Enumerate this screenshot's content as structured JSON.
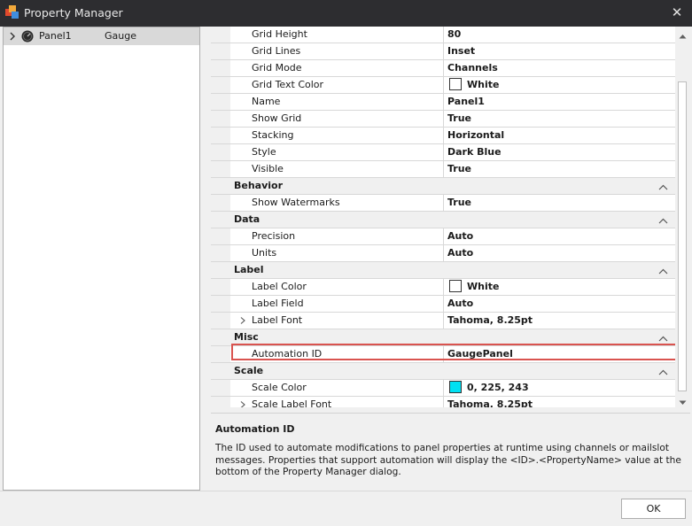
{
  "window": {
    "title": "Property Manager",
    "close_glyph": "✕"
  },
  "tree": {
    "items": [
      {
        "label": "Panel1",
        "type": "Gauge"
      }
    ]
  },
  "grid": {
    "appearance_rows": [
      {
        "name": "Grid Height",
        "value": "80"
      },
      {
        "name": "Grid Lines",
        "value": "Inset"
      },
      {
        "name": "Grid Mode",
        "value": "Channels"
      },
      {
        "name": "Grid Text Color",
        "value": "White",
        "color": "#ffffff"
      },
      {
        "name": "Name",
        "value": "Panel1"
      },
      {
        "name": "Show Grid",
        "value": "True"
      },
      {
        "name": "Stacking",
        "value": "Horizontal"
      },
      {
        "name": "Style",
        "value": "Dark Blue"
      },
      {
        "name": "Visible",
        "value": "True"
      }
    ],
    "categories": {
      "behavior": {
        "title": "Behavior",
        "rows": [
          {
            "name": "Show Watermarks",
            "value": "True"
          }
        ]
      },
      "data": {
        "title": "Data",
        "rows": [
          {
            "name": "Precision",
            "value": "Auto"
          },
          {
            "name": "Units",
            "value": "Auto"
          }
        ]
      },
      "label": {
        "title": "Label",
        "rows": [
          {
            "name": "Label Color",
            "value": "White",
            "color": "#ffffff"
          },
          {
            "name": "Label Field",
            "value": "Auto"
          },
          {
            "name": "Label Font",
            "value": "Tahoma, 8.25pt"
          }
        ]
      },
      "misc": {
        "title": "Misc",
        "rows": [
          {
            "name": "Automation ID",
            "value": "GaugePanel"
          }
        ]
      },
      "scale": {
        "title": "Scale",
        "rows": [
          {
            "name": "Scale Color",
            "value": "0, 225, 243",
            "color": "#00e1f3"
          },
          {
            "name": "Scale Label Font",
            "value": "Tahoma, 8.25pt"
          }
        ]
      }
    }
  },
  "description": {
    "title": "Automation ID",
    "text": "The ID used to automate modifications to panel properties at runtime using channels or mailslot messages. Properties that support automation will display the <ID>.<PropertyName> value at the bottom of the Property Manager dialog."
  },
  "buttons": {
    "ok": "OK"
  },
  "colors": {
    "titlebar": "#2d2d30",
    "highlight": "#d9534f",
    "selected_row": "#d9d9d9"
  }
}
